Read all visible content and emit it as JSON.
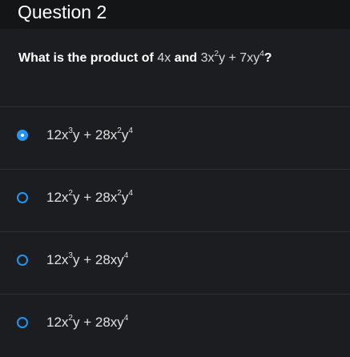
{
  "header": {
    "title": "Question 2"
  },
  "question": {
    "prefix": "What is the product of",
    "term1": "4x",
    "connector": "and",
    "expr": {
      "a": "3x",
      "a_exp": "2",
      "b": "y + 7xy",
      "b_exp": "4"
    },
    "suffix": "?"
  },
  "options": [
    {
      "selected": true,
      "p1": "12x",
      "e1": "3",
      "p2": "y + 28x",
      "e2": "2",
      "p3": "y",
      "e3": "4"
    },
    {
      "selected": false,
      "p1": "12x",
      "e1": "2",
      "p2": "y + 28x",
      "e2": "2",
      "p3": "y",
      "e3": "4"
    },
    {
      "selected": false,
      "p1": "12x",
      "e1": "3",
      "p2": "y + 28xy",
      "e2": "4",
      "p3": "",
      "e3": ""
    },
    {
      "selected": false,
      "p1": "12x",
      "e1": "2",
      "p2": "y + 28xy",
      "e2": "4",
      "p3": "",
      "e3": ""
    }
  ],
  "colors": {
    "accent": "#2196f3",
    "background": "#1b1d20",
    "header": "#141517"
  }
}
